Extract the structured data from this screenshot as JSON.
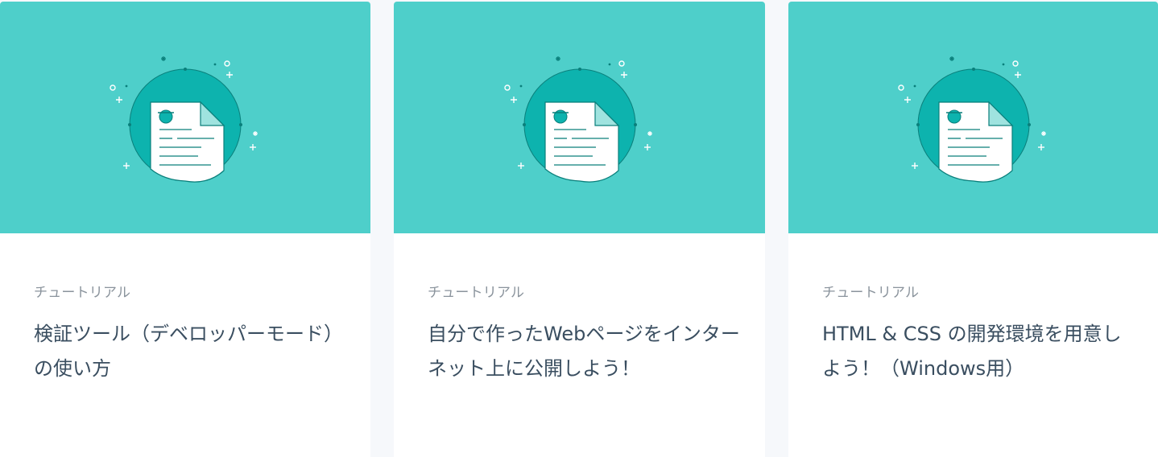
{
  "colors": {
    "thumbnail_bg": "#4ecfca",
    "circle": "#0db3ae",
    "doc_outline": "#0a7f7b",
    "category_text": "#8a939c",
    "title_text": "#3a4e60",
    "page_bg": "#f6f8fb"
  },
  "cards": [
    {
      "thumbnail_icon": "document-illustration-icon",
      "category": "チュートリアル",
      "title": "検証ツール（デベロッパーモード）の使い方"
    },
    {
      "thumbnail_icon": "document-illustration-icon",
      "category": "チュートリアル",
      "title": "自分で作ったWebページをインターネット上に公開しよう！"
    },
    {
      "thumbnail_icon": "document-illustration-icon",
      "category": "チュートリアル",
      "title": "HTML & CSS の開発環境を用意しよう！（Windows用）"
    }
  ]
}
